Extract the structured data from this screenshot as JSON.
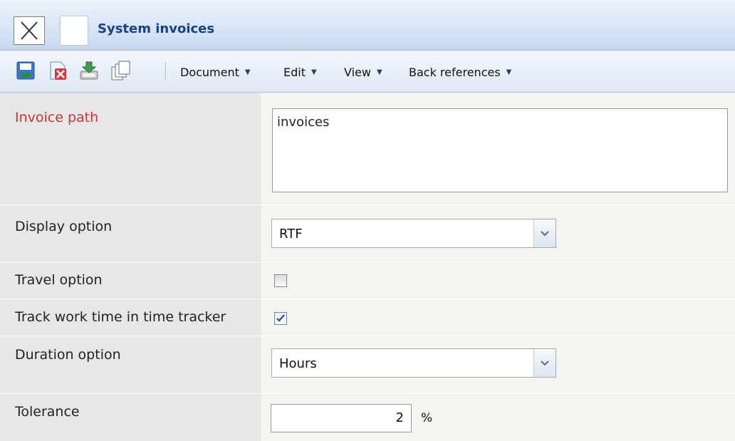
{
  "window": {
    "title": "System invoices"
  },
  "toolbar": {
    "icons": [
      "save-icon",
      "discard-icon",
      "export-icon",
      "copy-icon"
    ],
    "menus": [
      {
        "label": "Document"
      },
      {
        "label": "Edit"
      },
      {
        "label": "View"
      },
      {
        "label": "Back references"
      }
    ]
  },
  "form": {
    "invoice_path": {
      "label": "Invoice path",
      "value": "invoices",
      "required": true
    },
    "display_option": {
      "label": "Display option",
      "value": "RTF"
    },
    "travel_option": {
      "label": "Travel option",
      "checked": false
    },
    "track_work_time": {
      "label": "Track work time in time tracker",
      "checked": true
    },
    "duration_option": {
      "label": "Duration option",
      "value": "Hours"
    },
    "tolerance": {
      "label": "Tolerance",
      "value": "2",
      "unit": "%"
    }
  },
  "colors": {
    "title": "#15428b",
    "required_label": "#cc3333",
    "label_bg": "#e7e7e7",
    "value_bg": "#f5f4f1"
  }
}
